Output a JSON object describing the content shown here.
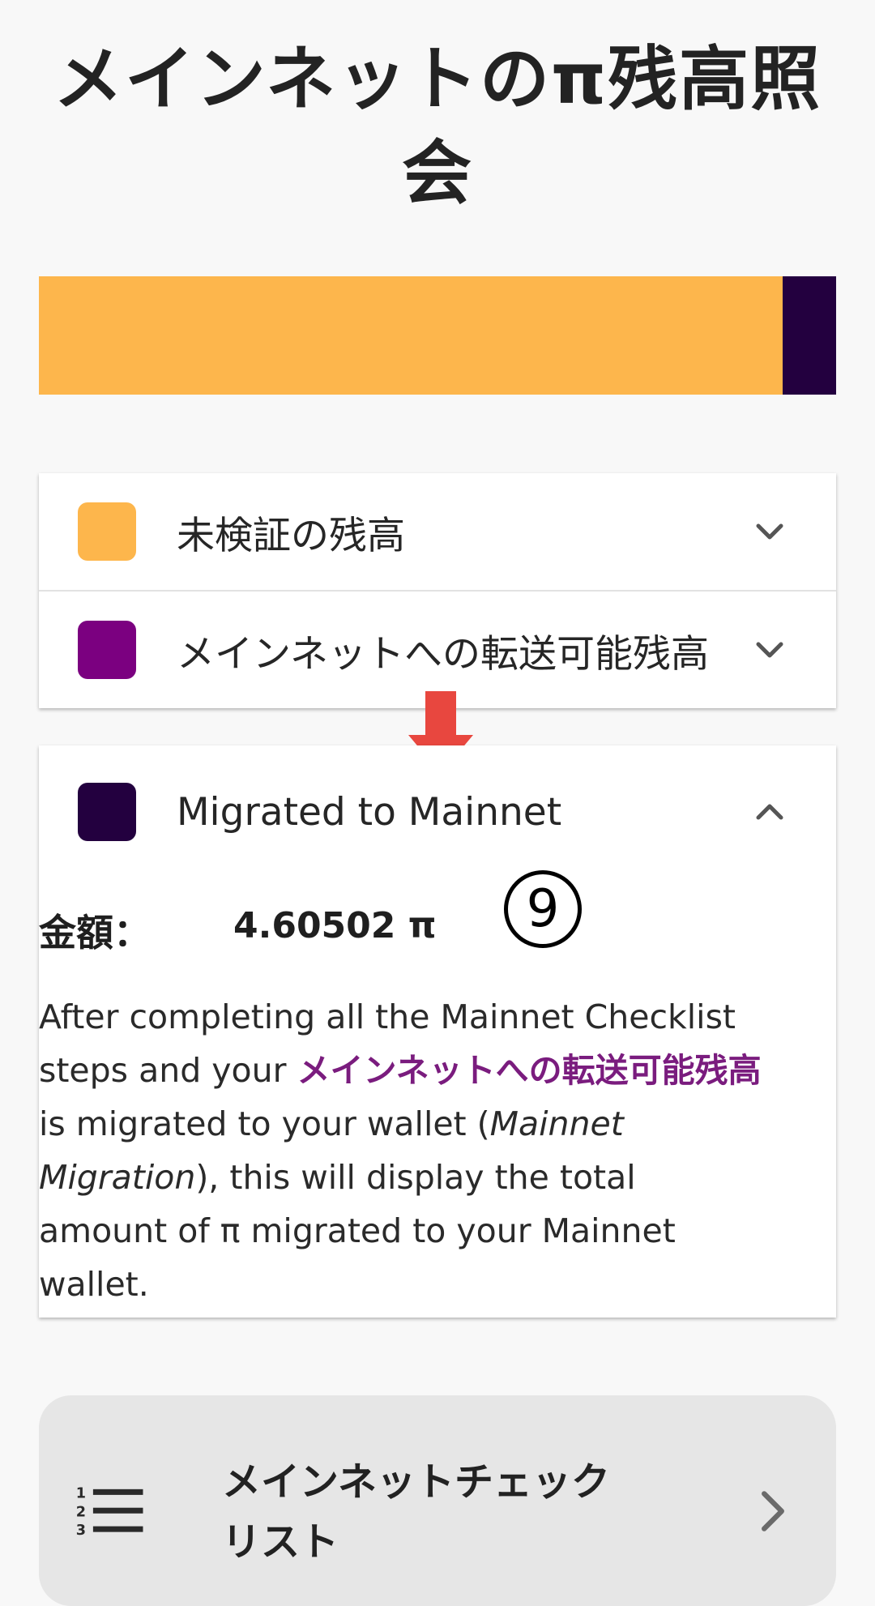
{
  "page": {
    "title": "メインネットのπ残高照会"
  },
  "balance_bar": {
    "segments": [
      {
        "name": "unverified",
        "fraction": 0.933,
        "color": "#FDB64C"
      },
      {
        "name": "migrated",
        "fraction": 0.067,
        "color": "#23003F"
      }
    ]
  },
  "rows": {
    "unverified": {
      "label": "未検証の残高",
      "color": "#FDB64C",
      "icon": "chevron-down-icon"
    },
    "transferable": {
      "label": "メインネットへの転送可能残高",
      "color": "#7B0080",
      "icon": "chevron-down-icon"
    },
    "migrated": {
      "label": "Migrated to Mainnet",
      "color": "#23003F",
      "icon": "chevron-up-icon"
    }
  },
  "migrated_detail": {
    "amount_label": "金額：",
    "amount_value": "4.60502 π",
    "annotation": "9",
    "desc_1": "After completing all the Mainnet Checklist steps and your ",
    "desc_highlight": "メインネットへの転送可能残高",
    "desc_2": " is migrated to your wallet (",
    "desc_italic": "Mainnet Migration",
    "desc_3": "), this will display the total amount of π migrated to your Mainnet wallet."
  },
  "checklist": {
    "label": "メインネットチェックリスト",
    "icon": "numbered-list-icon",
    "chevron": "chevron-right-icon"
  },
  "colors": {
    "arrow": "#E8473F",
    "highlight_text": "#7A1C7E"
  }
}
